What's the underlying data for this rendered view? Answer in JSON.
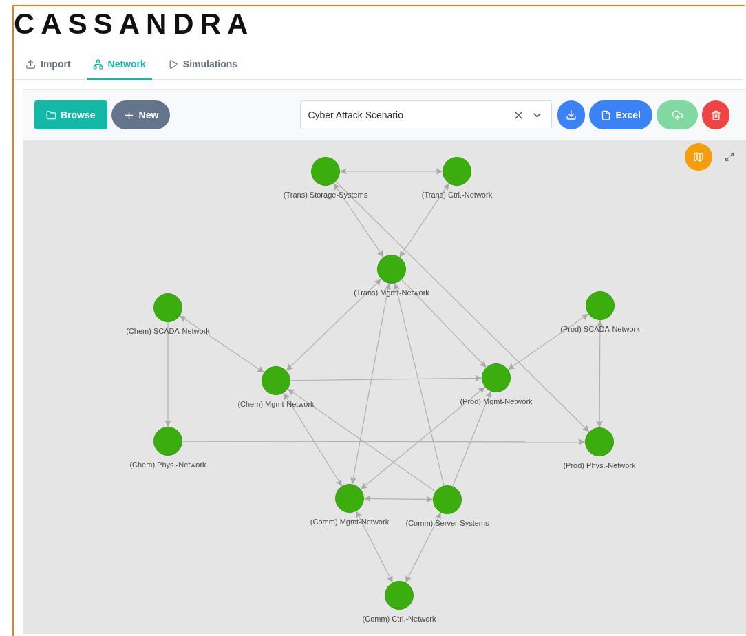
{
  "logo": "CASSANDRA",
  "tabs": [
    {
      "label": "Import",
      "kind": "import",
      "selected": false
    },
    {
      "label": "Network",
      "kind": "network",
      "selected": true
    },
    {
      "label": "Simulations",
      "kind": "play",
      "selected": false
    }
  ],
  "toolbar": {
    "left_buttons": [
      {
        "label": "Browse",
        "kind": "browse"
      },
      {
        "label": "New",
        "kind": "new"
      }
    ],
    "scenario_select": {
      "value": "Cyber Attack Scenario"
    },
    "right_buttons": [
      {
        "kind": "download",
        "disabled": false
      },
      {
        "label": "Excel",
        "kind": "excel",
        "disabled": false
      },
      {
        "kind": "upload",
        "disabled": true
      },
      {
        "kind": "delete",
        "disabled": false
      }
    ]
  },
  "graph": {
    "nodes": [
      {
        "label": "(Trans) Storage-Systems"
      },
      {
        "label": "(Trans) Ctrl.-Network"
      },
      {
        "label": "(Trans) Mgmt-Network"
      },
      {
        "label": "(Chem) SCADA-Network"
      },
      {
        "label": "(Chem) Mgmt-Network"
      },
      {
        "label": "(Chem) Phys.-Network"
      },
      {
        "label": "(Prod) SCADA-Network"
      },
      {
        "label": "(Prod) Mgmt-Network"
      },
      {
        "label": "(Prod) Phys.-Network"
      },
      {
        "label": "(Comm) Mgmt-Network"
      },
      {
        "label": "(Comm) Server-Systems"
      },
      {
        "label": "(Comm) Ctrl.-Network"
      }
    ]
  }
}
